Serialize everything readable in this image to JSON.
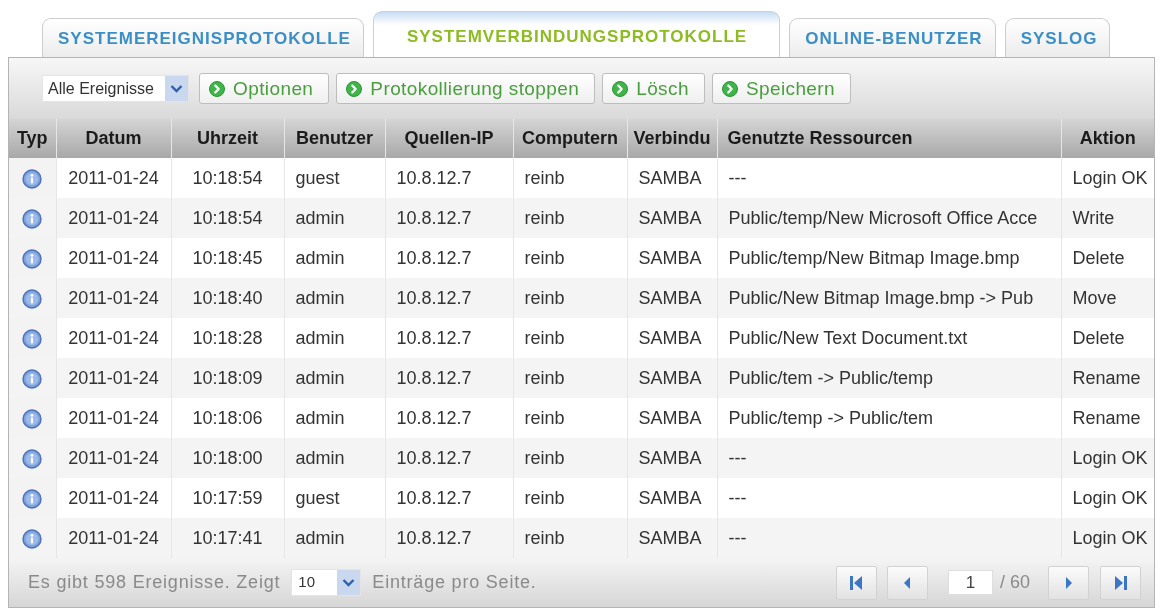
{
  "tabs": [
    {
      "label": "SYSTEMEREIGNISPROTOKOLLE",
      "selected": false
    },
    {
      "label": "SYSTEMVERBINDUNGSPROTOKOLLE",
      "selected": true
    },
    {
      "label": "ONLINE-BENUTZER",
      "selected": false
    },
    {
      "label": "SYSLOG",
      "selected": false
    }
  ],
  "toolbar": {
    "filter": {
      "value": "Alle Ereignisse"
    },
    "buttons": [
      "Optionen",
      "Protokollierung stoppen",
      "Lösch",
      "Speichern"
    ]
  },
  "table": {
    "columns": [
      "Typ",
      "Datum",
      "Uhrzeit",
      "Benutzer",
      "Quellen-IP",
      "Computern",
      "Verbindu",
      "Genutzte Ressourcen",
      "Aktion"
    ],
    "rows": [
      [
        "",
        "2011-01-24",
        "10:18:54",
        "guest",
        "10.8.12.7",
        "reinb",
        "SAMBA",
        "---",
        "Login OK"
      ],
      [
        "",
        "2011-01-24",
        "10:18:54",
        "admin",
        "10.8.12.7",
        "reinb",
        "SAMBA",
        "Public/temp/New Microsoft Office Acce",
        "Write"
      ],
      [
        "",
        "2011-01-24",
        "10:18:45",
        "admin",
        "10.8.12.7",
        "reinb",
        "SAMBA",
        "Public/temp/New Bitmap Image.bmp",
        "Delete"
      ],
      [
        "",
        "2011-01-24",
        "10:18:40",
        "admin",
        "10.8.12.7",
        "reinb",
        "SAMBA",
        "Public/New Bitmap Image.bmp -> Pub",
        "Move"
      ],
      [
        "",
        "2011-01-24",
        "10:18:28",
        "admin",
        "10.8.12.7",
        "reinb",
        "SAMBA",
        "Public/New Text Document.txt",
        "Delete"
      ],
      [
        "",
        "2011-01-24",
        "10:18:09",
        "admin",
        "10.8.12.7",
        "reinb",
        "SAMBA",
        "Public/tem -> Public/temp",
        "Rename"
      ],
      [
        "",
        "2011-01-24",
        "10:18:06",
        "admin",
        "10.8.12.7",
        "reinb",
        "SAMBA",
        "Public/temp -> Public/tem",
        "Rename"
      ],
      [
        "",
        "2011-01-24",
        "10:18:00",
        "admin",
        "10.8.12.7",
        "reinb",
        "SAMBA",
        "---",
        "Login OK"
      ],
      [
        "",
        "2011-01-24",
        "10:17:59",
        "guest",
        "10.8.12.7",
        "reinb",
        "SAMBA",
        "---",
        "Login OK"
      ],
      [
        "",
        "2011-01-24",
        "10:17:41",
        "admin",
        "10.8.12.7",
        "reinb",
        "SAMBA",
        "---",
        "Login OK"
      ]
    ]
  },
  "footer": {
    "summary": "Es gibt 598 Ereignisse. Zeigt",
    "page_size": "10",
    "page_size_label": "Einträge pro Seite.",
    "page": "1",
    "page_total": "/ 60"
  }
}
